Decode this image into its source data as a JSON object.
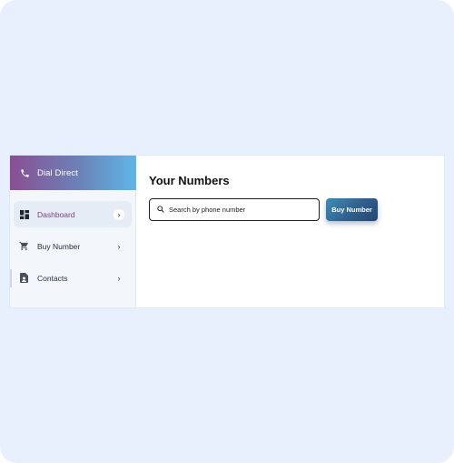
{
  "brand": {
    "label": "Dial Direct",
    "icon": "phone-icon"
  },
  "nav": {
    "items": [
      {
        "label": "Dashboard",
        "icon": "dashboard-icon",
        "active": true
      },
      {
        "label": "Buy Number",
        "icon": "cart-icon",
        "active": false
      },
      {
        "label": "Contacts",
        "icon": "contacts-icon",
        "active": false
      }
    ]
  },
  "main": {
    "title": "Your Numbers",
    "search_placeholder": "Search by phone number",
    "buy_button_label": "Buy Number"
  },
  "colors": {
    "accent_purple": "#8a4f93",
    "accent_blue": "#5fb6e6",
    "button_dark": "#2f5f8e",
    "backdrop": "#e9f0fd"
  }
}
